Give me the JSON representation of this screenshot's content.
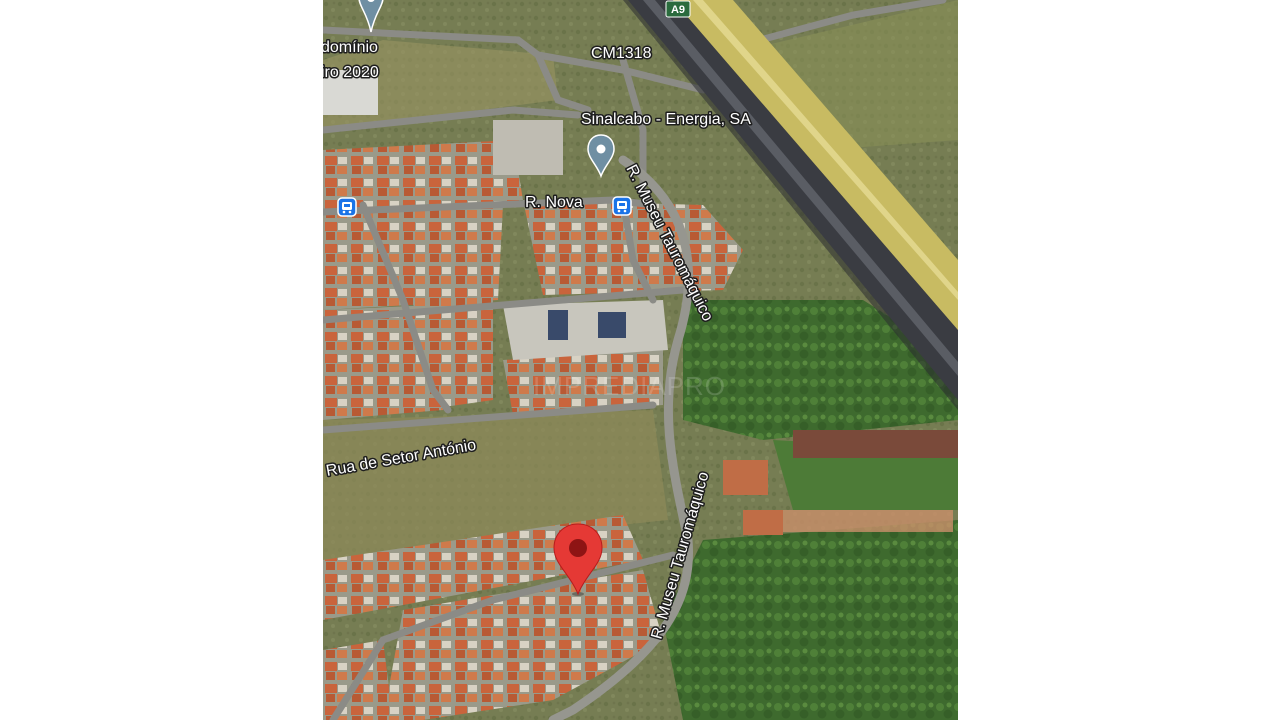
{
  "map": {
    "labels": {
      "condominio_line1": "domínio",
      "condominio_line2": "iro 2020",
      "highway_shield": "A9",
      "road_cm1318": "CM1318",
      "poi_sinalcabo": "Sinalcabo - Energia, SA",
      "street_r_nova": "R. Nova",
      "street_museu_north": "R. Museu Tauromáquico",
      "street_museu_south": "R. Museu Tauromáquico",
      "street_setor_antonio": "Rua de Setor António",
      "watermark": "IMPREDIAPRO"
    },
    "colors": {
      "pin_red": "#e53935",
      "pin_dark": "#8e1414",
      "poi_pin": "#6f8fa3",
      "bus_stop": "#1a73e8",
      "highway_asphalt": "#3a3c42",
      "highway_embankment": "#c8bb62",
      "road": "#8b8b86"
    },
    "icons": [
      "location-pin-icon",
      "poi-pin-icon",
      "bus-stop-icon",
      "highway-shield-icon"
    ]
  }
}
